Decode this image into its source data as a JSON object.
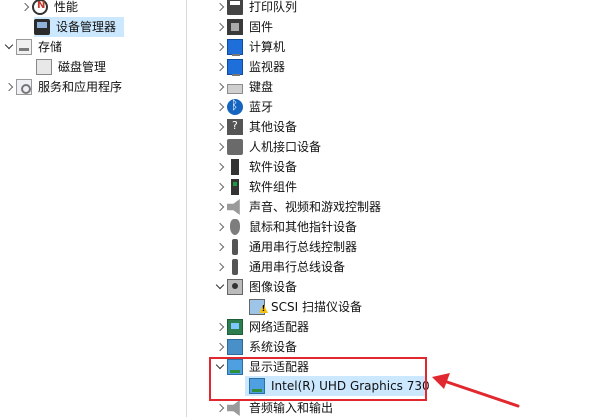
{
  "left_tree": {
    "items": [
      {
        "label": "性能",
        "icon": "performance-icon"
      },
      {
        "label": "设备管理器",
        "icon": "device-manager-icon",
        "selected": true
      },
      {
        "label": "存储",
        "icon": "storage-icon",
        "expanded": true
      },
      {
        "label": "磁盘管理",
        "icon": "disk-management-icon"
      },
      {
        "label": "服务和应用程序",
        "icon": "services-icon"
      }
    ]
  },
  "device_tree": {
    "items": [
      {
        "label": "打印队列",
        "icon": "print-queue-icon"
      },
      {
        "label": "固件",
        "icon": "firmware-icon"
      },
      {
        "label": "计算机",
        "icon": "computer-icon"
      },
      {
        "label": "监视器",
        "icon": "monitor-icon"
      },
      {
        "label": "键盘",
        "icon": "keyboard-icon"
      },
      {
        "label": "蓝牙",
        "icon": "bluetooth-icon"
      },
      {
        "label": "其他设备",
        "icon": "other-devices-icon"
      },
      {
        "label": "人机接口设备",
        "icon": "hid-icon"
      },
      {
        "label": "软件设备",
        "icon": "software-device-icon"
      },
      {
        "label": "软件组件",
        "icon": "software-component-icon"
      },
      {
        "label": "声音、视频和游戏控制器",
        "icon": "sound-controller-icon"
      },
      {
        "label": "鼠标和其他指针设备",
        "icon": "mouse-icon"
      },
      {
        "label": "通用串行总线控制器",
        "icon": "usb-controller-icon"
      },
      {
        "label": "通用串行总线设备",
        "icon": "usb-device-icon"
      },
      {
        "label": "图像设备",
        "icon": "imaging-device-icon",
        "expanded": true
      },
      {
        "label": "SCSI 扫描仪设备",
        "icon": "scanner-warning-icon"
      },
      {
        "label": "网络适配器",
        "icon": "network-adapter-icon"
      },
      {
        "label": "系统设备",
        "icon": "system-device-icon"
      },
      {
        "label": "显示适配器",
        "icon": "display-adapter-icon",
        "expanded": true
      },
      {
        "label": "Intel(R) UHD Graphics 730",
        "icon": "gpu-icon"
      },
      {
        "label": "音频输入和输出",
        "icon": "audio-io-icon"
      }
    ]
  },
  "annotation": {
    "box_color": "#e0282e",
    "arrow_color": "#e0282e"
  }
}
